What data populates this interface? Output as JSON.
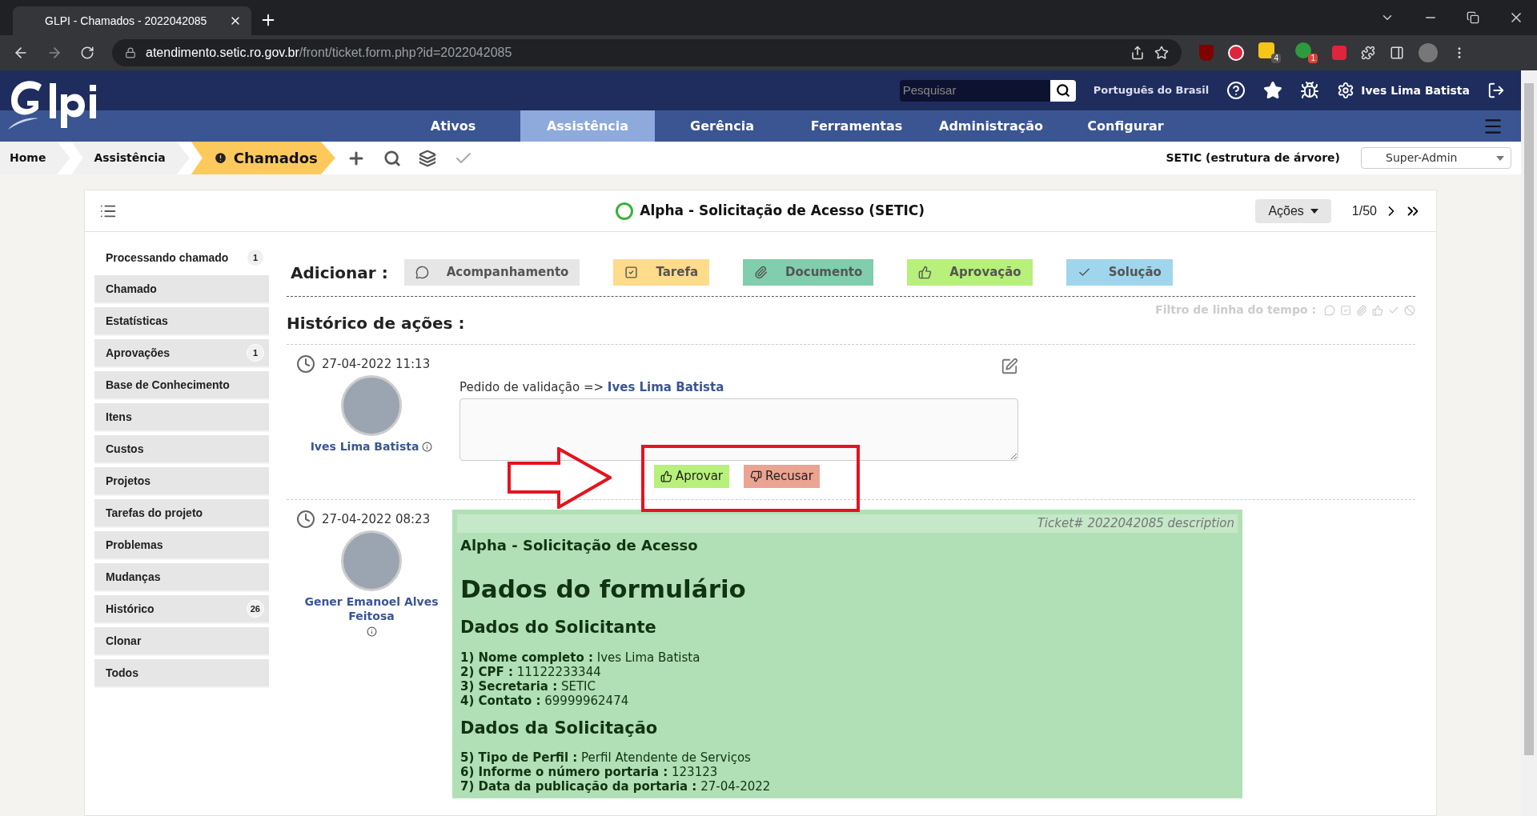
{
  "browser": {
    "tab_title": "GLPI - Chamados - 2022042085",
    "url_host": "atendimento.setic.ro.gov.br",
    "url_path": "/front/ticket.form.php?id=2022042085",
    "extension_badges": [
      "4",
      "1"
    ]
  },
  "header": {
    "search": {
      "placeholder": "Pesquisar"
    },
    "language": "Português do Brasil",
    "user": "Ives Lima Batista"
  },
  "nav": [
    {
      "label": "Ativos",
      "selected": false
    },
    {
      "label": "Assistência",
      "selected": true
    },
    {
      "label": "Gerência",
      "selected": false
    },
    {
      "label": "Ferramentas",
      "selected": false
    },
    {
      "label": "Administração",
      "selected": false
    },
    {
      "label": "Configurar",
      "selected": false
    }
  ],
  "breadcrumb": [
    {
      "label": "Home",
      "current": false
    },
    {
      "label": "Assistência",
      "current": false
    },
    {
      "label": "Chamados",
      "current": true
    }
  ],
  "entity": "SETIC (estrutura de árvore)",
  "profile": "Super-Admin",
  "ticket": {
    "title": "Alpha - Solicitação de Acesso (SETIC)",
    "actions": "Ações",
    "pager": "1/50"
  },
  "sidebar": [
    {
      "label": "Processando chamado",
      "count": "1",
      "selected": true
    },
    {
      "label": "Chamado",
      "selected": false
    },
    {
      "label": "Estatísticas",
      "selected": false
    },
    {
      "label": "Aprovações",
      "count": "1",
      "selected": false
    },
    {
      "label": "Base de Conhecimento",
      "selected": false
    },
    {
      "label": "Itens",
      "selected": false
    },
    {
      "label": "Custos",
      "selected": false
    },
    {
      "label": "Projetos",
      "selected": false
    },
    {
      "label": "Tarefas do projeto",
      "selected": false
    },
    {
      "label": "Problemas",
      "selected": false
    },
    {
      "label": "Mudanças",
      "selected": false
    },
    {
      "label": "Histórico",
      "count": "26",
      "selected": false
    },
    {
      "label": "Clonar",
      "selected": false
    },
    {
      "label": "Todos",
      "selected": false
    }
  ],
  "add_label": "Adicionar :",
  "add_buttons": [
    {
      "kind": "followup",
      "label": "Acompanhamento",
      "color": "#e6e6e6"
    },
    {
      "kind": "task",
      "label": "Tarefa",
      "color": "#ffdb8c"
    },
    {
      "kind": "document",
      "label": "Documento",
      "color": "#80cead"
    },
    {
      "kind": "validation",
      "label": "Aprovação",
      "color": "#b7f07a"
    },
    {
      "kind": "solution",
      "label": "Solução",
      "color": "#9fd6ed"
    }
  ],
  "history_title": "Histórico de ações :",
  "timeline_filter": "Filtro de linha do tempo :",
  "entries": [
    {
      "kind": "validation",
      "date": "27-04-2022 11:13",
      "author": "Ives Lima Batista",
      "text": "Pedido de validação =>",
      "target": "Ives Lima Batista",
      "approve": "Aprovar",
      "refuse": "Recusar"
    },
    {
      "kind": "description",
      "date": "27-04-2022 08:23",
      "author": "Gener Emanoel Alves Feitosa",
      "tag": "Ticket# 2022042085 description",
      "title": "Alpha - Solicitação de Acesso",
      "heading": "Dados do formulário",
      "sections": [
        {
          "title": "Dados do Solicitante",
          "lines": [
            "**1) Nome completo :** Ives Lima Batista",
            "**2) CPF :** 11122233344",
            "**3) Secretaria :** SETIC",
            "**4) Contato :** 69999962474"
          ]
        },
        {
          "title": "Dados da Solicitação",
          "lines": [
            "**5) Tipo de Perfil :** Perfil Atendente de Serviços",
            "**6) Informe o número portaria :** 123123",
            "**7) Data da publicação da portaria :** 27-04-2022"
          ]
        }
      ]
    }
  ]
}
